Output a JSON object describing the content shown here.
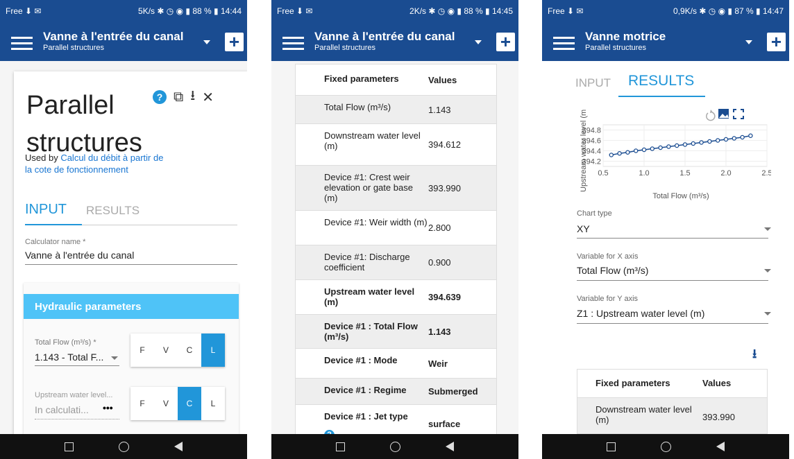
{
  "phones": [
    {
      "status": {
        "carrier": "Free",
        "speed": "5K/s",
        "battery": "88 %",
        "time": "14:44"
      },
      "appbar": {
        "title": "Vanne à l'entrée du canal",
        "subtitle": "Parallel structures"
      },
      "card": {
        "title_line1": "Parallel",
        "title_line2": "structures",
        "used_by_prefix": "Used by ",
        "used_by_link": "Calcul du débit à partir de la cote de fonctionnement",
        "tabs": {
          "input": "INPUT",
          "results": "RESULTS"
        },
        "calc_name_label": "Calculator name *",
        "calc_name_value": "Vanne à l'entrée du canal",
        "section_title": "Hydraulic parameters",
        "params": [
          {
            "label": "Total Flow (m³/s) *",
            "value": "1.143 - Total F...",
            "mode": "L"
          },
          {
            "label": "Upstream water level...",
            "value": "In calculati...",
            "mode": "C"
          }
        ],
        "mode_buttons": [
          "F",
          "V",
          "C",
          "L"
        ]
      }
    },
    {
      "status": {
        "carrier": "Free",
        "speed": "2K/s",
        "battery": "88 %",
        "time": "14:45"
      },
      "appbar": {
        "title": "Vanne à l'entrée du canal",
        "subtitle": "Parallel structures"
      },
      "table": {
        "header": [
          "Fixed parameters",
          "Values"
        ],
        "rows": [
          {
            "label": "Total Flow (m³/s)",
            "value": "1.143",
            "bold": false
          },
          {
            "label": "Downstream water level (m)",
            "value": "394.612",
            "bold": false
          },
          {
            "label": "Device #1: Crest weir elevation or gate base (m)",
            "value": "393.990",
            "bold": false
          },
          {
            "label": "Device #1: Weir width (m)",
            "value": "2.800",
            "bold": false
          },
          {
            "label": "Device #1: Discharge coefficient",
            "value": "0.900",
            "bold": false
          },
          {
            "label": "Upstream water level (m)",
            "value": "394.639",
            "bold": true
          },
          {
            "label": "Device #1 : Total Flow (m³/s)",
            "value": "1.143",
            "bold": true
          },
          {
            "label": "Device #1 : Mode",
            "value": "Weir",
            "bold": true
          },
          {
            "label": "Device #1 : Regime",
            "value": "Submerged",
            "bold": true
          },
          {
            "label": "Device #1 : Jet type",
            "value": "surface",
            "bold": true
          }
        ]
      }
    },
    {
      "status": {
        "carrier": "Free",
        "speed": "0,9K/s",
        "battery": "87 %",
        "time": "14:47"
      },
      "appbar": {
        "title": "Vanne motrice",
        "subtitle": "Parallel structures"
      },
      "tabs": {
        "input": "INPUT",
        "results": "RESULTS"
      },
      "chart_type": {
        "label": "Chart type",
        "value": "XY"
      },
      "x_axis": {
        "label": "Variable for X axis",
        "value": "Total Flow (m³/s)"
      },
      "y_axis": {
        "label": "Variable for Y axis",
        "value": "Z1 : Upstream water level (m)"
      },
      "table": {
        "header": [
          "Fixed parameters",
          "Values"
        ],
        "rows": [
          {
            "label": "Downstream water level (m)",
            "value": "393.990"
          }
        ]
      }
    }
  ],
  "chart_data": {
    "type": "scatter",
    "xlabel": "Total Flow (m³/s)",
    "ylabel": "Upstream water level (m",
    "xlim": [
      0.5,
      2.5
    ],
    "ylim": [
      394.1,
      394.9
    ],
    "xticks": [
      "0.5",
      "1.0",
      "1.5",
      "2.0",
      "2.5"
    ],
    "yticks": [
      "394.2",
      "394.4",
      "394.6",
      "394.8"
    ],
    "series": [
      {
        "x": [
          0.6,
          0.7,
          0.8,
          0.9,
          1.0,
          1.1,
          1.2,
          1.3,
          1.4,
          1.5,
          1.6,
          1.7,
          1.8,
          1.9,
          2.0,
          2.1,
          2.2,
          2.3
        ],
        "y": [
          394.32,
          394.35,
          394.37,
          394.4,
          394.42,
          394.44,
          394.46,
          394.48,
          394.5,
          394.52,
          394.54,
          394.56,
          394.58,
          394.6,
          394.62,
          394.64,
          394.66,
          394.69
        ]
      }
    ]
  }
}
